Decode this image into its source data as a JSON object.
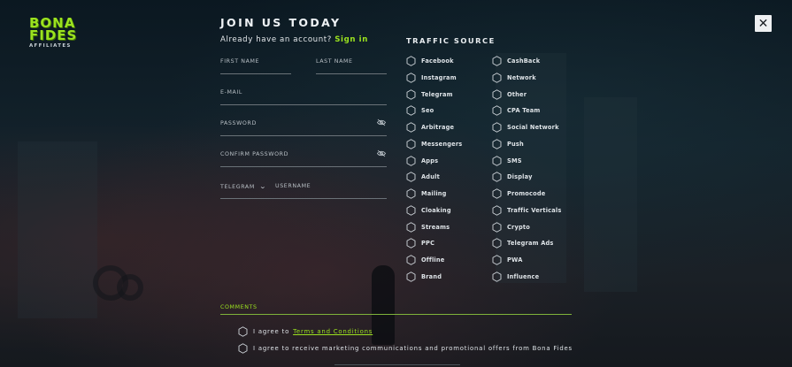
{
  "brand": {
    "logo_line1": "BONA",
    "logo_line2": "FIDES",
    "logo_line3": "AFFILIATES"
  },
  "header": {
    "title": "JOIN US TODAY",
    "close_label": "✕"
  },
  "account": {
    "prompt": "Already have an account?",
    "signin_label": "Sign in"
  },
  "form": {
    "first_name": "FIRST NAME",
    "last_name": "LAST NAME",
    "email": "E-MAIL",
    "password": "PASSWORD",
    "confirm_password": "CONFIRM PASSWORD",
    "messenger_select": "TELEGRAM",
    "username": "USERNAME",
    "comments": "COMMENTS"
  },
  "traffic": {
    "title": "TRAFFIC SOURCE",
    "col1": [
      "Facebook",
      "Instagram",
      "Telegram",
      "Seo",
      "Arbitrage",
      "Messengers",
      "Apps",
      "Adult",
      "Mailing",
      "Cloaking",
      "Streams",
      "PPC",
      "Offline",
      "Brand"
    ],
    "col2": [
      "CashBack",
      "Network",
      "Other",
      "CPA Team",
      "Social Network",
      "Push",
      "SMS",
      "Display",
      "Promocode",
      "Traffic Verticals",
      "Crypto",
      "Telegram Ads",
      "PWA",
      "Influence"
    ]
  },
  "agreements": {
    "terms_prefix": "I agree to",
    "terms_link": "Terms and Conditions",
    "marketing": "I agree to receive marketing communications and promotional offers from Bona Fides"
  },
  "colors": {
    "accent": "#9be21f",
    "background": "#0e1a22"
  },
  "icons": {
    "option": "hexagon-checkbox-icon",
    "password_toggle": "eye-off-icon",
    "select": "chevron-down-icon",
    "close": "close-icon"
  }
}
